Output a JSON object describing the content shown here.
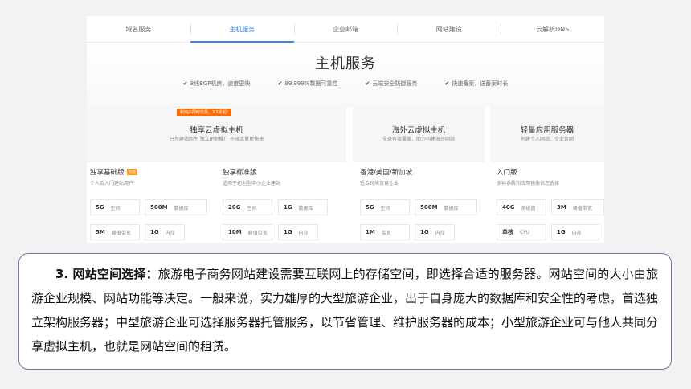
{
  "nav": {
    "tabs": [
      {
        "label": "域名服务"
      },
      {
        "label": "主机服务"
      },
      {
        "label": "企业邮箱"
      },
      {
        "label": "网站建设"
      },
      {
        "label": "云解析DNS"
      }
    ],
    "active_index": 1,
    "accent_color": "#3a85e8"
  },
  "hero": {
    "title": "主机服务",
    "features": [
      "8线BGP机房，速度更快",
      "99.999%数据可靠性",
      "云端安全防御服务",
      "快速备案，送备案时长"
    ]
  },
  "columns": [
    {
      "ribbon": "新用户限时优惠，3.5折起!",
      "title": "独享云虚拟主机",
      "subtitle": "只为建站而生   独立IP助推广   不限流量更快速",
      "plans": [
        {
          "name": "独享基础版",
          "badge": "热销",
          "desc": "个人及入门建站用户",
          "specs": [
            {
              "value": "5G",
              "unit": "空间"
            },
            {
              "value": "500M",
              "unit": "数据库"
            },
            {
              "value": "5M",
              "unit": "峰值带宽"
            },
            {
              "value": "1G",
              "unit": "内存"
            }
          ]
        },
        {
          "name": "独享标准版",
          "desc": "适用于初创型中小企业建站",
          "specs": [
            {
              "value": "20G",
              "unit": "空间"
            },
            {
              "value": "1G",
              "unit": "数据库"
            },
            {
              "value": "10M",
              "unit": "峰值带宽"
            },
            {
              "value": "1G",
              "unit": "内存"
            }
          ]
        }
      ]
    },
    {
      "title": "海外云虚拟主机",
      "subtitle": "全球有效覆盖，助力构建海外网站",
      "plans": [
        {
          "name": "香港/美国/新加坡",
          "desc": "适合跨境贸易企业",
          "specs": [
            {
              "value": "5G",
              "unit": "空间"
            },
            {
              "value": "500M",
              "unit": "数据库"
            },
            {
              "value": "1M",
              "unit": "带宽"
            },
            {
              "value": "1G",
              "unit": "内存"
            }
          ]
        }
      ]
    },
    {
      "title": "轻量应用服务器",
      "subtitle": "创建个人网站、企业官网",
      "plans": [
        {
          "name": "入门版",
          "desc": "多种系统和应用镜像供您选择",
          "specs": [
            {
              "value": "40G",
              "unit": "系统盘"
            },
            {
              "value": "3M",
              "unit": "峰值带宽"
            },
            {
              "value": "单核",
              "unit": "CPU"
            },
            {
              "value": "1G",
              "unit": "内存"
            }
          ]
        }
      ]
    }
  ],
  "note": {
    "lead": "3. 网站空间选择：",
    "body": "旅游电子商务网站建设需要互联网上的存储空间，即选择合适的服务器。网站空间的大小由旅游企业规模、网站功能等决定。一般来说，实力雄厚的大型旅游企业，出于自身庞大的数据库和安全性的考虑，首选独立架构服务器；中型旅游企业可选择服务器托管服务，以节省管理、维护服务器的成本；小型旅游企业可与他人共同分享虚拟主机，也就是网站空间的租赁。"
  }
}
